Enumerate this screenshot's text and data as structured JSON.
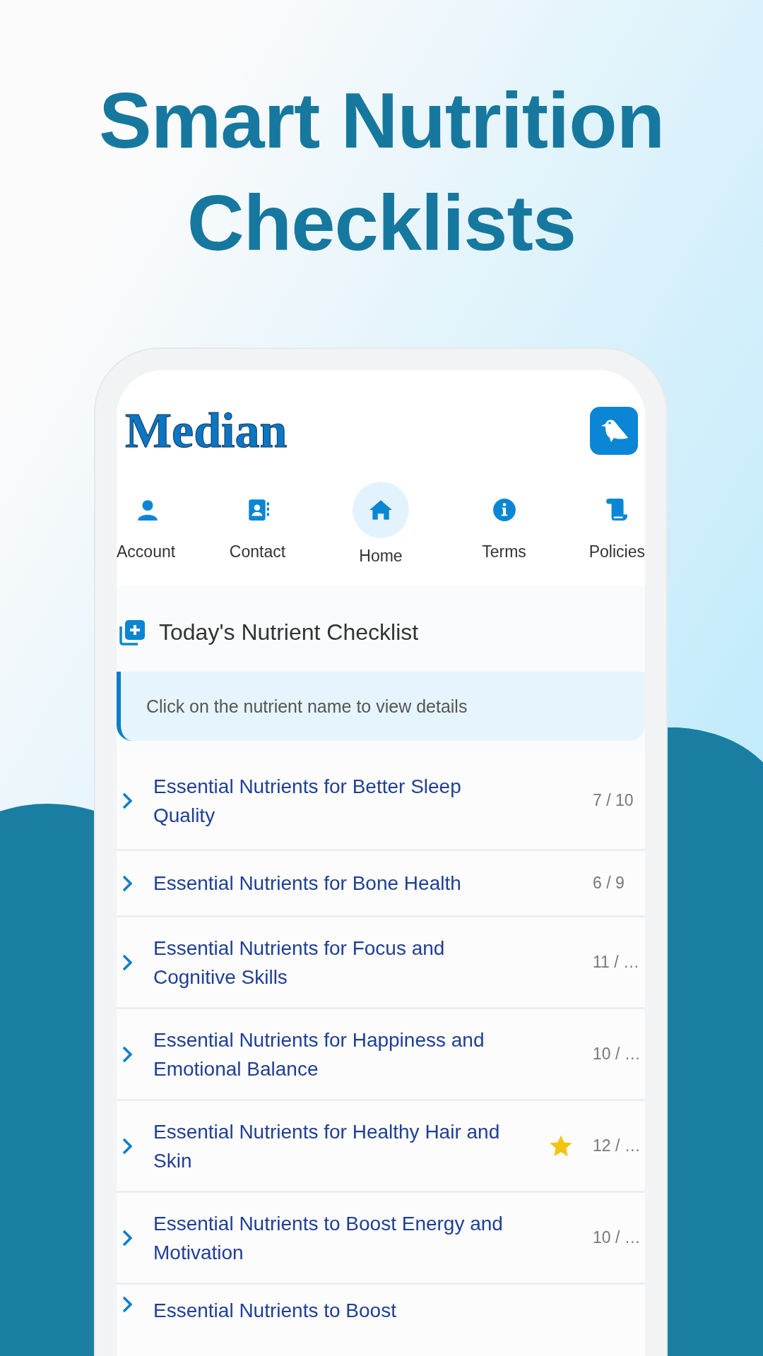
{
  "headline": [
    "Smart Nutrition",
    "Checklists"
  ],
  "app": {
    "logo": "Median"
  },
  "nav": [
    {
      "label": "Account",
      "selected": false
    },
    {
      "label": "Contact",
      "selected": false
    },
    {
      "label": "Home",
      "selected": true
    },
    {
      "label": "Terms",
      "selected": false
    },
    {
      "label": "Policies",
      "selected": false
    }
  ],
  "section": {
    "title": "Today's Nutrient Checklist",
    "hint": "Click on the nutrient name to view details"
  },
  "checklists": [
    {
      "title": "Essential Nutrients for Better Sleep Quality",
      "count": "7 / 10",
      "starred": false
    },
    {
      "title": "Essential Nutrients for Bone Health",
      "count": "6 / 9",
      "starred": false
    },
    {
      "title": "Essential Nutrients for Focus and Cognitive Skills",
      "count": "11 / …",
      "starred": false
    },
    {
      "title": "Essential Nutrients for Happiness and Emotional Balance",
      "count": "10 / …",
      "starred": false
    },
    {
      "title": "Essential Nutrients for Healthy Hair and Skin",
      "count": "12 / …",
      "starred": true
    },
    {
      "title": "Essential Nutrients to Boost Energy and Motivation",
      "count": "10 / …",
      "starred": false
    },
    {
      "title": "Essential Nutrients to Boost",
      "starred": false
    }
  ]
}
